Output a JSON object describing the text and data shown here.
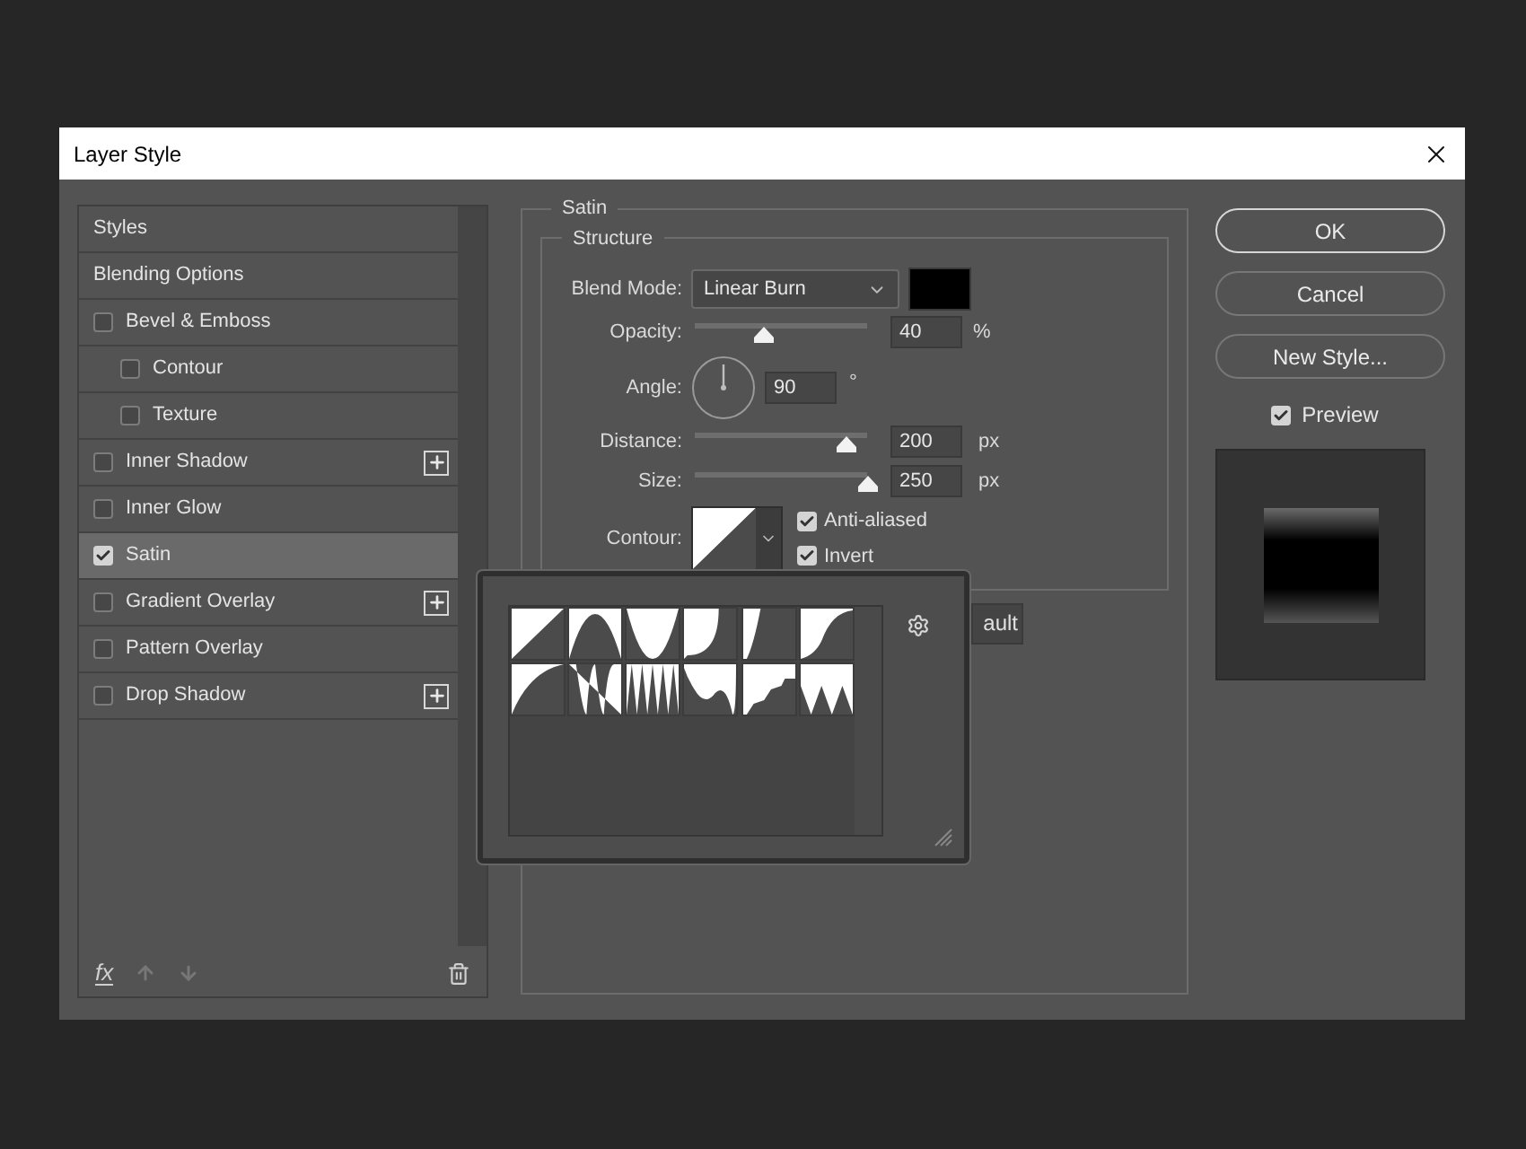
{
  "window": {
    "title": "Layer Style"
  },
  "styles_list": [
    {
      "label": "Styles",
      "kind": "header",
      "selected": false
    },
    {
      "label": "Blending Options",
      "kind": "header",
      "selected": false
    },
    {
      "label": "Bevel & Emboss",
      "kind": "effect",
      "checked": false,
      "selected": false,
      "addable": false,
      "children": [
        {
          "label": "Contour",
          "kind": "effect",
          "checked": false,
          "selected": false,
          "addable": false
        },
        {
          "label": "Texture",
          "kind": "effect",
          "checked": false,
          "selected": false,
          "addable": false
        }
      ]
    },
    {
      "label": "Inner Shadow",
      "kind": "effect",
      "checked": false,
      "selected": false,
      "addable": true
    },
    {
      "label": "Inner Glow",
      "kind": "effect",
      "checked": false,
      "selected": false,
      "addable": false
    },
    {
      "label": "Satin",
      "kind": "effect",
      "checked": true,
      "selected": true,
      "addable": false
    },
    {
      "label": "Gradient Overlay",
      "kind": "effect",
      "checked": false,
      "selected": false,
      "addable": true
    },
    {
      "label": "Pattern Overlay",
      "kind": "effect",
      "checked": false,
      "selected": false,
      "addable": false
    },
    {
      "label": "Drop Shadow",
      "kind": "effect",
      "checked": false,
      "selected": false,
      "addable": true
    }
  ],
  "list_toolbar": {
    "fx_label": "fx"
  },
  "satin": {
    "title": "Satin",
    "structure": {
      "title": "Structure",
      "blend_mode": {
        "label": "Blend Mode:",
        "value": "Linear Burn",
        "color": "#000000"
      },
      "opacity": {
        "label": "Opacity:",
        "level": 0.4,
        "value": "40",
        "unit": "%"
      },
      "angle": {
        "label": "Angle:",
        "value": "90",
        "unit": "°"
      },
      "distance": {
        "label": "Distance:",
        "level": 0.87,
        "value": "200",
        "unit": "px"
      },
      "size": {
        "label": "Size:",
        "level": 1,
        "value": "250",
        "unit": "px"
      },
      "contour": {
        "label": "Contour:",
        "picker_open": true
      },
      "anti_aliased": {
        "label": "Anti-aliased",
        "checked": true
      },
      "invert": {
        "label": "Invert",
        "checked": true
      }
    },
    "default_button": "ault"
  },
  "buttons": [
    {
      "label": "OK",
      "default": true
    },
    {
      "label": "Cancel",
      "default": false
    },
    {
      "label": "New Style...",
      "default": false
    }
  ],
  "preview": {
    "label": "Preview",
    "checked": true
  }
}
